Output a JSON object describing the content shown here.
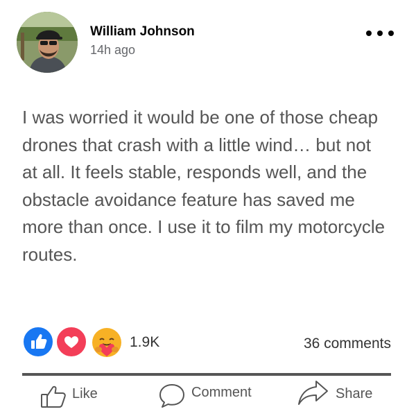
{
  "post": {
    "author": "William Johnson",
    "time": "14h ago",
    "more_icon": "more-horizontal-icon",
    "text": "I was worried it would be one of those cheap drones that crash with a little wind… but not at all. It feels stable, responds well, and the obstacle avoidance feature has saved me more than once. I use it to film my motorcycle routes.",
    "reactions": {
      "types": [
        "like",
        "love",
        "care"
      ],
      "count": "1.9K",
      "colors": {
        "like": "#1877f2",
        "love": "#f33e58",
        "care": "#f7b125"
      }
    },
    "comments_count": "36 comments",
    "actions": [
      {
        "label": "Like",
        "icon": "thumbs-up-icon"
      },
      {
        "label": "Comment",
        "icon": "speech-bubble-icon"
      },
      {
        "label": "Share",
        "icon": "share-arrow-icon"
      }
    ]
  }
}
